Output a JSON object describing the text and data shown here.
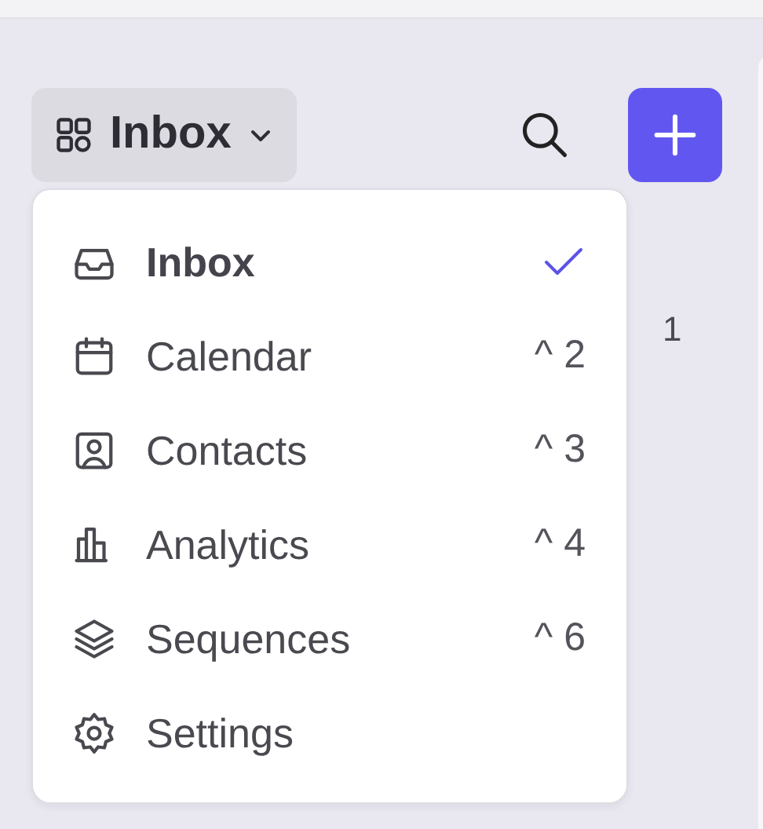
{
  "switcher": {
    "label": "Inbox"
  },
  "menu": [
    {
      "label": "Inbox",
      "selected": true
    },
    {
      "label": "Calendar",
      "selected": false,
      "shortcut": "^ 2"
    },
    {
      "label": "Contacts",
      "selected": false,
      "shortcut": "^ 3"
    },
    {
      "label": "Analytics",
      "selected": false,
      "shortcut": "^ 4"
    },
    {
      "label": "Sequences",
      "selected": false,
      "shortcut": "^ 6"
    },
    {
      "label": "Settings",
      "selected": false
    }
  ],
  "background_text": "1"
}
